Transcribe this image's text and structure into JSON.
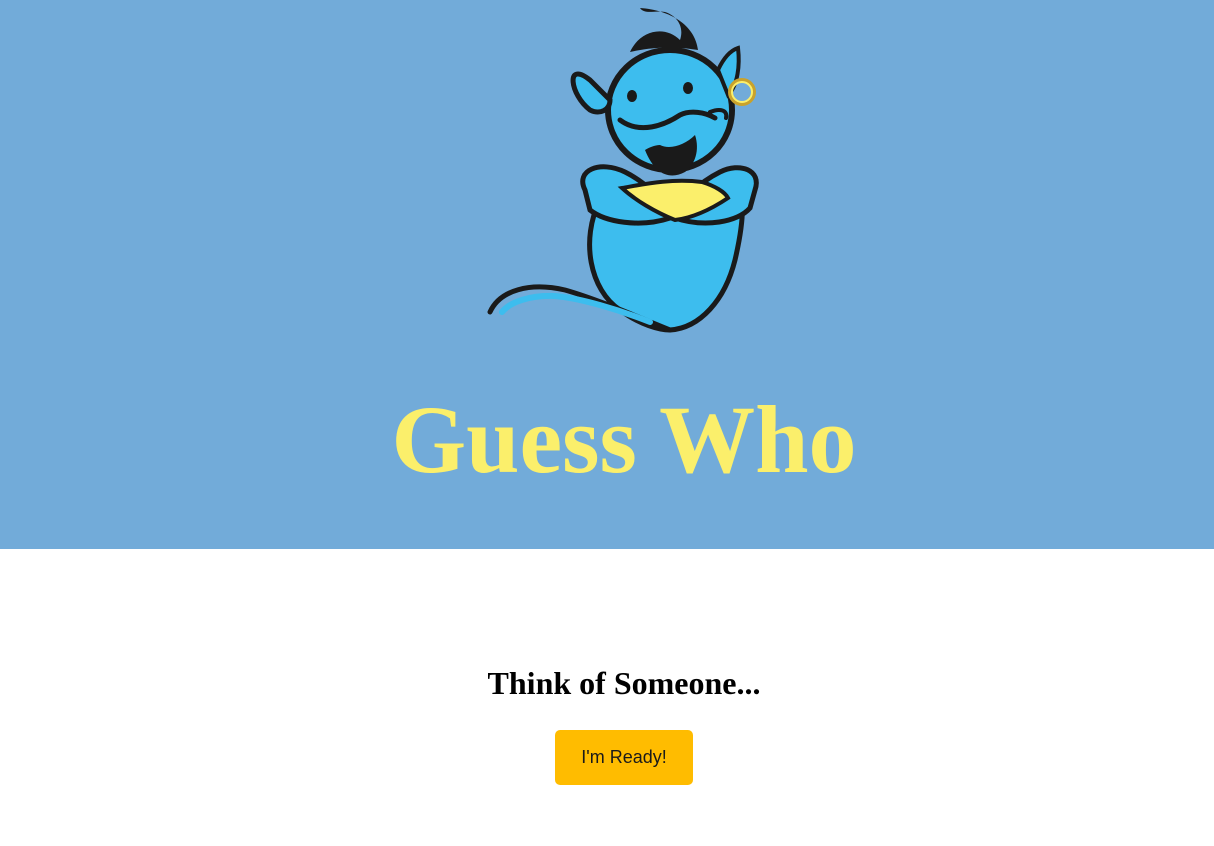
{
  "colors": {
    "hero_background": "#72abd9",
    "title_color": "#fbef6b",
    "button_background": "#ffbc00",
    "genie_body": "#3dbdee",
    "genie_outline": "#1a1a1a",
    "genie_vest": "#fbef6b"
  },
  "hero": {
    "logo_icon": "genie-icon",
    "title": "Guess Who"
  },
  "main": {
    "prompt": "Think of Someone...",
    "ready_button_label": "I'm Ready!"
  }
}
